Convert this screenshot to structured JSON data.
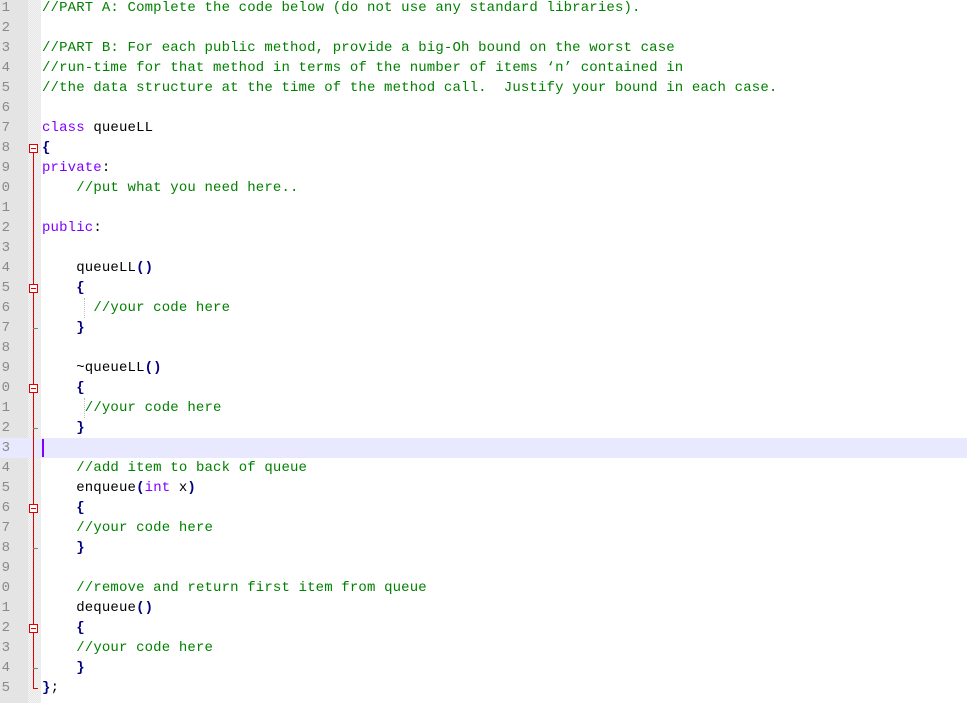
{
  "editor": {
    "line_numbers": [
      "1",
      "2",
      "3",
      "4",
      "5",
      "6",
      "7",
      "8",
      "9",
      "0",
      "1",
      "2",
      "3",
      "4",
      "5",
      "6",
      "7",
      "8",
      "9",
      "0",
      "1",
      "2",
      "3",
      "4",
      "5",
      "6",
      "7",
      "8",
      "9",
      "0",
      "1",
      "2",
      "3",
      "4",
      "5"
    ],
    "current_line_index": 22,
    "lines": [
      [
        {
          "t": "//PART A: Complete the code below (do not use any standard libraries).",
          "c": "cm"
        }
      ],
      [],
      [
        {
          "t": "//PART B: For each public method, provide a big-Oh bound on the worst case",
          "c": "cm"
        }
      ],
      [
        {
          "t": "//run-time for that method in terms of the number of items ‘n’ contained in",
          "c": "cm"
        }
      ],
      [
        {
          "t": "//the data structure at the time of the method call.  Justify your bound in each case.",
          "c": "cm"
        }
      ],
      [],
      [
        {
          "t": "class",
          "c": "kw"
        },
        {
          "t": " queueLL",
          "c": ""
        }
      ],
      [
        {
          "t": "{",
          "c": "op"
        }
      ],
      [
        {
          "t": "private",
          "c": "kw"
        },
        {
          "t": ":",
          "c": ""
        }
      ],
      [
        {
          "t": "    ",
          "c": ""
        },
        {
          "t": "//put what you need here..",
          "c": "cm"
        }
      ],
      [],
      [
        {
          "t": "public",
          "c": "kw"
        },
        {
          "t": ":",
          "c": ""
        }
      ],
      [],
      [
        {
          "t": "    queueLL",
          "c": ""
        },
        {
          "t": "()",
          "c": "op"
        }
      ],
      [
        {
          "t": "    ",
          "c": ""
        },
        {
          "t": "{",
          "c": "op"
        }
      ],
      [
        {
          "t": "      ",
          "c": ""
        },
        {
          "t": "//your code here",
          "c": "cm"
        }
      ],
      [
        {
          "t": "    ",
          "c": ""
        },
        {
          "t": "}",
          "c": "op"
        }
      ],
      [],
      [
        {
          "t": "    ~queueLL",
          "c": ""
        },
        {
          "t": "()",
          "c": "op"
        }
      ],
      [
        {
          "t": "    ",
          "c": ""
        },
        {
          "t": "{",
          "c": "op"
        }
      ],
      [
        {
          "t": "     ",
          "c": ""
        },
        {
          "t": "//your code here",
          "c": "cm"
        }
      ],
      [
        {
          "t": "    ",
          "c": ""
        },
        {
          "t": "}",
          "c": "op"
        }
      ],
      [],
      [
        {
          "t": "    ",
          "c": ""
        },
        {
          "t": "//add item to back of queue",
          "c": "cm"
        }
      ],
      [
        {
          "t": "    enqueue",
          "c": ""
        },
        {
          "t": "(",
          "c": "op"
        },
        {
          "t": "int",
          "c": "kw"
        },
        {
          "t": " x",
          "c": ""
        },
        {
          "t": ")",
          "c": "op"
        }
      ],
      [
        {
          "t": "    ",
          "c": ""
        },
        {
          "t": "{",
          "c": "op"
        }
      ],
      [
        {
          "t": "    ",
          "c": ""
        },
        {
          "t": "//your code here",
          "c": "cm"
        }
      ],
      [
        {
          "t": "    ",
          "c": ""
        },
        {
          "t": "}",
          "c": "op"
        }
      ],
      [],
      [
        {
          "t": "    ",
          "c": ""
        },
        {
          "t": "//remove and return first item from queue",
          "c": "cm"
        }
      ],
      [
        {
          "t": "    dequeue",
          "c": ""
        },
        {
          "t": "()",
          "c": "op"
        }
      ],
      [
        {
          "t": "    ",
          "c": ""
        },
        {
          "t": "{",
          "c": "op"
        }
      ],
      [
        {
          "t": "    ",
          "c": ""
        },
        {
          "t": "//your code here",
          "c": "cm"
        }
      ],
      [
        {
          "t": "    ",
          "c": ""
        },
        {
          "t": "}",
          "c": "op"
        }
      ],
      [
        {
          "t": "}",
          "c": "op"
        },
        {
          "t": ";",
          "c": ""
        }
      ]
    ],
    "fold_markers": [
      {
        "line": 7,
        "kind": "open"
      },
      {
        "line": 14,
        "kind": "open"
      },
      {
        "line": 19,
        "kind": "open"
      },
      {
        "line": 25,
        "kind": "open"
      },
      {
        "line": 31,
        "kind": "open"
      }
    ],
    "fold_ends": [
      16,
      21,
      27,
      33
    ],
    "class_end": 34
  }
}
